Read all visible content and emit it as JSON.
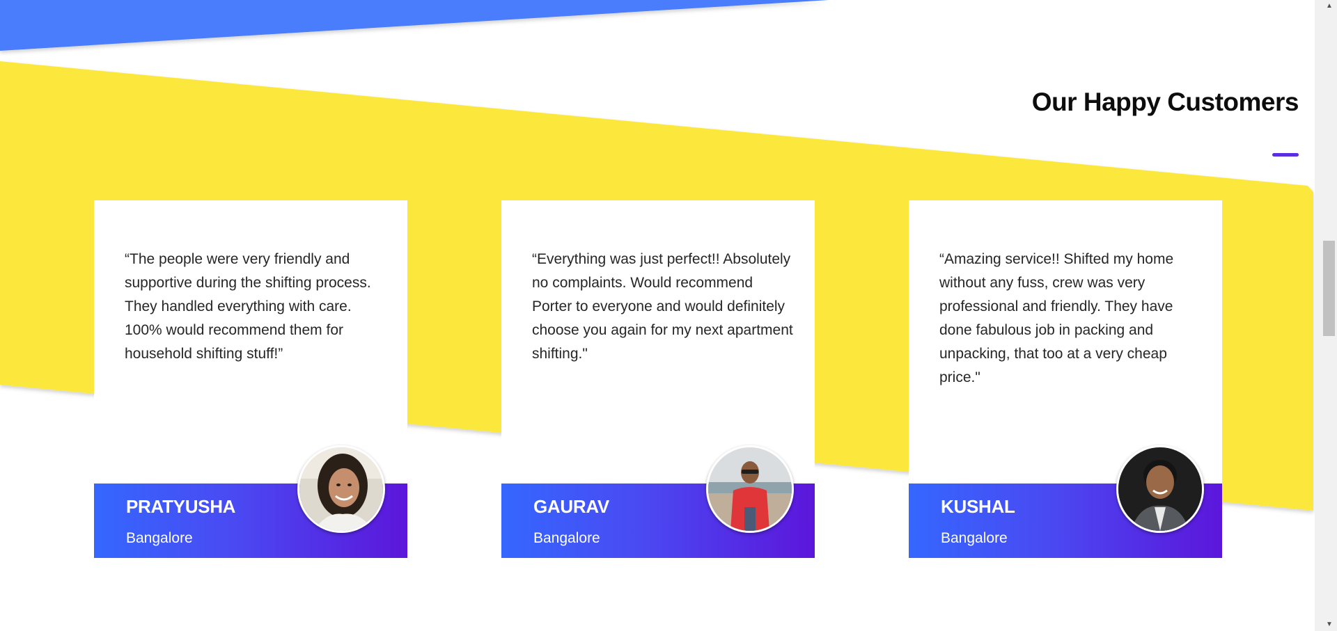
{
  "section": {
    "title": "Our Happy Customers"
  },
  "colors": {
    "blue_band": "#4a7dfb",
    "yellow_band": "#fce83e",
    "accent": "#5b2ee0",
    "footer_gradient_start": "#3567ff",
    "footer_gradient_end": "#5c16db"
  },
  "testimonials": [
    {
      "quote": "“The people were very friendly and supportive during the shifting process. They handled everything with care. 100% would recommend them for household shifting stuff!”",
      "name": "PRATYUSHA",
      "city": "Bangalore",
      "avatar": "customer-photo"
    },
    {
      "quote": "“Everything was just perfect!! Absolutely no complaints. Would recommend Porter to everyone and would definitely choose you again for my next apartment shifting.\"",
      "name": "GAURAV",
      "city": "Bangalore",
      "avatar": "customer-photo"
    },
    {
      "quote": "“Amazing service!! Shifted my home without any fuss, crew was very professional and friendly. They have done fabulous job in packing and unpacking, that too at a very cheap price.\"",
      "name": "KUSHAL",
      "city": "Bangalore",
      "avatar": "customer-photo"
    }
  ],
  "scrollbar": {
    "up_arrow": "▲",
    "down_arrow": "▼"
  }
}
